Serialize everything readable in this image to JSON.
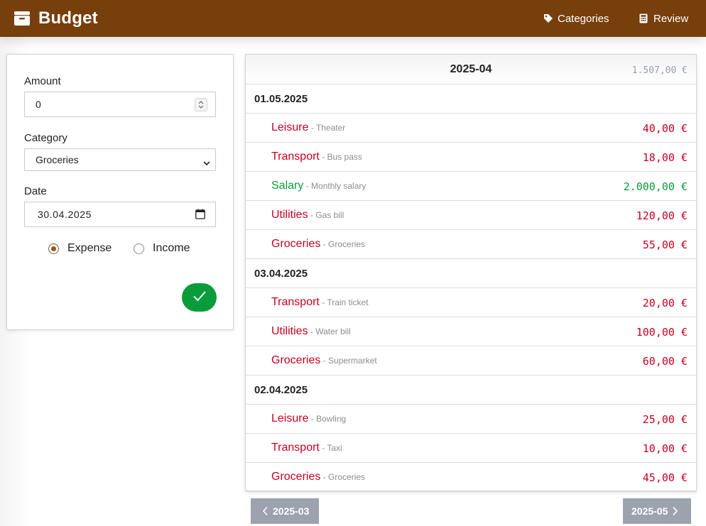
{
  "header": {
    "title": "Budget",
    "nav": [
      {
        "label": "Categories",
        "icon": "tag-icon"
      },
      {
        "label": "Review",
        "icon": "calculator-icon"
      }
    ]
  },
  "form": {
    "amount_label": "Amount",
    "amount_value": "0",
    "category_label": "Category",
    "category_value": "Groceries",
    "date_label": "Date",
    "date_value": "30.04.2025",
    "type_options": [
      {
        "label": "Expense",
        "checked": true
      },
      {
        "label": "Income",
        "checked": false
      }
    ],
    "submit_icon": "check-icon"
  },
  "list": {
    "month": "2025-04",
    "total": "1.507,00 €",
    "rows": [
      {
        "kind": "date",
        "date": "01.05.2025"
      },
      {
        "kind": "entry",
        "type": "expense",
        "category": "Leisure",
        "description": "Theater",
        "amount": "40,00 €"
      },
      {
        "kind": "entry",
        "type": "expense",
        "category": "Transport",
        "description": "Bus pass",
        "amount": "18,00 €"
      },
      {
        "kind": "entry",
        "type": "income",
        "category": "Salary",
        "description": "Monthly salary",
        "amount": "2.000,00 €"
      },
      {
        "kind": "entry",
        "type": "expense",
        "category": "Utilities",
        "description": "Gas bill",
        "amount": "120,00 €"
      },
      {
        "kind": "entry",
        "type": "expense",
        "category": "Groceries",
        "description": "Groceries",
        "amount": "55,00 €"
      },
      {
        "kind": "date",
        "date": "03.04.2025"
      },
      {
        "kind": "entry",
        "type": "expense",
        "category": "Transport",
        "description": "Train ticket",
        "amount": "20,00 €"
      },
      {
        "kind": "entry",
        "type": "expense",
        "category": "Utilities",
        "description": "Water bill",
        "amount": "100,00 €"
      },
      {
        "kind": "entry",
        "type": "expense",
        "category": "Groceries",
        "description": "Supermarket",
        "amount": "60,00 €"
      },
      {
        "kind": "date",
        "date": "02.04.2025"
      },
      {
        "kind": "entry",
        "type": "expense",
        "category": "Leisure",
        "description": "Bowling",
        "amount": "25,00 €"
      },
      {
        "kind": "entry",
        "type": "expense",
        "category": "Transport",
        "description": "Taxi",
        "amount": "10,00 €"
      },
      {
        "kind": "entry",
        "type": "expense",
        "category": "Groceries",
        "description": "Groceries",
        "amount": "45,00 €"
      }
    ]
  },
  "pager": {
    "prev_label": "2025-03",
    "next_label": "2025-05"
  },
  "colors": {
    "header_bg": "#773f0c",
    "expense": "#c8001e",
    "income": "#0a9c3b",
    "pager_bg": "#9ca3ae"
  }
}
